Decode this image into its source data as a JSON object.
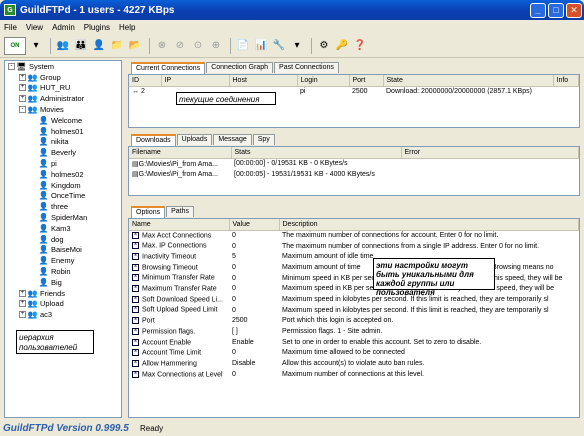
{
  "window": {
    "title": "GuildFTPd - 1 users - 4227 KBps"
  },
  "menu": [
    "File",
    "View",
    "Admin",
    "Plugins",
    "Help"
  ],
  "toolbar": {
    "on_label": "ON"
  },
  "tree": [
    {
      "label": "System",
      "level": 0,
      "box": "-",
      "kind": "pc"
    },
    {
      "label": "Group",
      "level": 1,
      "box": "+",
      "kind": "group"
    },
    {
      "label": "HUT_RU",
      "level": 1,
      "box": "+",
      "kind": "group"
    },
    {
      "label": "Administrator",
      "level": 1,
      "box": "+",
      "kind": "group"
    },
    {
      "label": "Movies",
      "level": 1,
      "box": "-",
      "kind": "group"
    },
    {
      "label": "Welcome",
      "level": 2,
      "box": "",
      "kind": "user"
    },
    {
      "label": "holmes01",
      "level": 2,
      "box": "",
      "kind": "user"
    },
    {
      "label": "nikita",
      "level": 2,
      "box": "",
      "kind": "user"
    },
    {
      "label": "Beverly",
      "level": 2,
      "box": "",
      "kind": "user"
    },
    {
      "label": "pi",
      "level": 2,
      "box": "",
      "kind": "user"
    },
    {
      "label": "holmes02",
      "level": 2,
      "box": "",
      "kind": "user"
    },
    {
      "label": "Kingdom",
      "level": 2,
      "box": "",
      "kind": "user"
    },
    {
      "label": "OnceTime",
      "level": 2,
      "box": "",
      "kind": "user"
    },
    {
      "label": "three",
      "level": 2,
      "box": "",
      "kind": "user"
    },
    {
      "label": "SpiderMan",
      "level": 2,
      "box": "",
      "kind": "user"
    },
    {
      "label": "Kam3",
      "level": 2,
      "box": "",
      "kind": "user"
    },
    {
      "label": "dog",
      "level": 2,
      "box": "",
      "kind": "user"
    },
    {
      "label": "BaiseMoi",
      "level": 2,
      "box": "",
      "kind": "user"
    },
    {
      "label": "Enemy",
      "level": 2,
      "box": "",
      "kind": "user"
    },
    {
      "label": "Robin",
      "level": 2,
      "box": "",
      "kind": "user"
    },
    {
      "label": "Big",
      "level": 2,
      "box": "",
      "kind": "user"
    },
    {
      "label": "Friends",
      "level": 1,
      "box": "+",
      "kind": "group"
    },
    {
      "label": "Upload",
      "level": 1,
      "box": "+",
      "kind": "group"
    },
    {
      "label": "ac3",
      "level": 1,
      "box": "+",
      "kind": "group"
    }
  ],
  "annotations": {
    "hierarchy": "иерархия пользователей",
    "connections": "текущие соединения",
    "settings": "эти настройки могут быть уникальными для каждой группы или пользователя"
  },
  "conn": {
    "tabs": [
      "Current Connections",
      "Connection Graph",
      "Past Connections"
    ],
    "headers": [
      "ID",
      "IP",
      "Host",
      "Login",
      "Port",
      "State",
      "Info"
    ],
    "rows": [
      [
        "2",
        "",
        "",
        "pi",
        "2500",
        "Download: 20000000/20000000 (2857.1 KBps)",
        ""
      ]
    ]
  },
  "dl": {
    "tabs": [
      "Downloads",
      "Uploads",
      "Message",
      "Spy"
    ],
    "headers": [
      "Filename",
      "Stats",
      "Error"
    ],
    "rows": [
      [
        "G:\\Movies\\Pi_from Ama...",
        "[00:00:00] - 0/19531 KB - 0 KBytes/s",
        ""
      ],
      [
        "G:\\Movies\\Pi_from Ama...",
        "[00:00:05] - 19531/19531 KB - 4000 KBytes/s",
        ""
      ]
    ]
  },
  "opts": {
    "tabs": [
      "Options",
      "Paths"
    ],
    "headers": [
      "Name",
      "Value",
      "Description"
    ],
    "rows": [
      [
        "Max Acct Connections",
        "0",
        "The maximum number of connections for account.  Enter 0 for no limit."
      ],
      [
        "Max. IP Connections",
        "0",
        "The maximum number of connections from a single IP address.  Enter 0 for no limit."
      ],
      [
        "Inactivity Timeout",
        "5",
        "Maximum amount of idle time"
      ],
      [
        "Browsing Timeout",
        "0",
        "Maximum amount of time",
        "Browsing means no"
      ],
      [
        "Minimum Transfer Rate",
        "0",
        "Minimum speed in KB per second",
        "this speed, they will be"
      ],
      [
        "Maximum Transfer Rate",
        "0",
        "Maximum speed in KB per second.  If the user cannot stay below this speed, they will be"
      ],
      [
        "Soft Download Speed Li...",
        "0",
        "Maximum speed in kilobytes per second.  If this limit is reached, they are temporarily sl"
      ],
      [
        "Soft Upload Speed Limit",
        "0",
        "Maximum speed in kilobytes per second.  If this limit is reached, they are temporarily sl"
      ],
      [
        "Port",
        "2500",
        "Port which this login is accepted on."
      ],
      [
        "Permission flags.",
        "[ ]",
        "Permission flags. 1 - Site admin."
      ],
      [
        "Account Enable",
        "Enable",
        "Set to one in order to enable this account.  Set to zero to disable."
      ],
      [
        "Account Time Limit",
        "0",
        "Maximum time allowed to be connected"
      ],
      [
        "Allow Hammering",
        "Disable",
        "Allow this account(s) to violate auto ban rules."
      ],
      [
        "Max Connections at Level",
        "0",
        "Maximum number of connections at this level."
      ]
    ]
  },
  "status": {
    "app": "GuildFTPd Version 0.999.5",
    "text": "Ready"
  }
}
